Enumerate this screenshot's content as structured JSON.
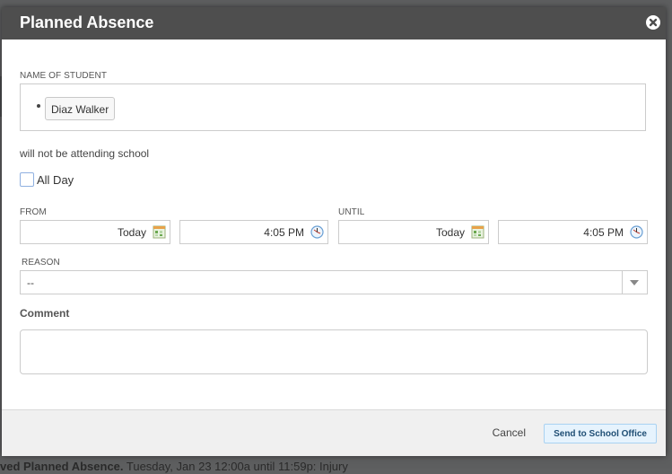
{
  "background": {
    "bottom_text_bold": "ved Planned Absence.",
    "bottom_text_rest": " Tuesday, Jan 23 12:00a until 11:59p: Injury"
  },
  "modal": {
    "title": "Planned Absence",
    "close_icon": "close-circle-icon",
    "student_label": "Name of Student",
    "students": [
      "Diaz Walker"
    ],
    "attending_text": "will not be attending school",
    "all_day": {
      "label": "All Day",
      "checked": false
    },
    "from": {
      "label": "From",
      "date": "Today",
      "time": "4:05 PM"
    },
    "until": {
      "label": "Until",
      "date": "Today",
      "time": "4:05 PM"
    },
    "reason": {
      "label": "Reason",
      "selected": "--"
    },
    "comment": {
      "label": "Comment",
      "value": ""
    },
    "footer": {
      "cancel_label": "Cancel",
      "send_label": "Send to School Office"
    }
  },
  "colors": {
    "header_bg": "#4e4e4e",
    "footer_bg": "#f0f0f0",
    "primary_button_bg": "#e6f3fd",
    "primary_button_text": "#1f4e74"
  }
}
